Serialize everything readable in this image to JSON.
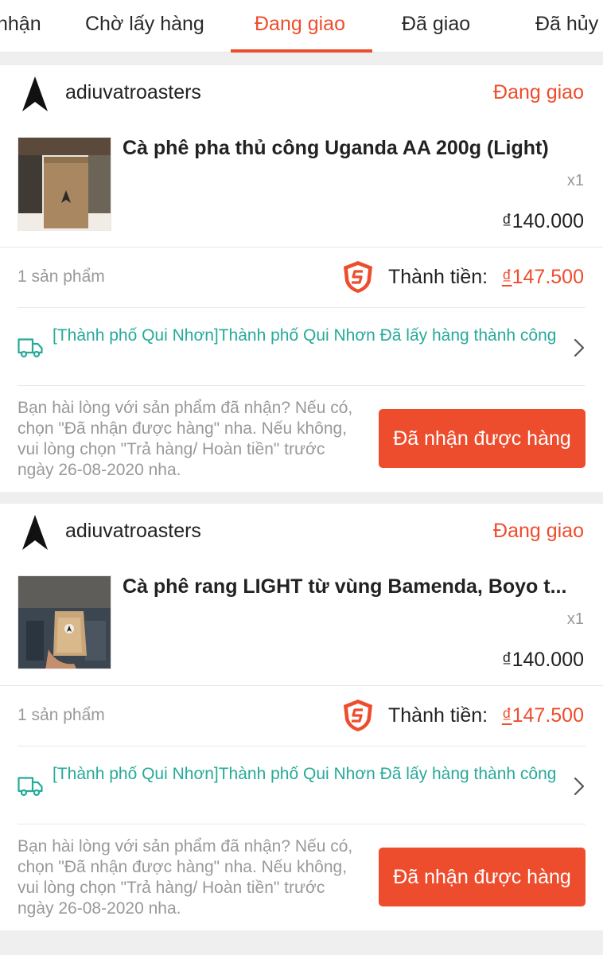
{
  "tabs": [
    {
      "label": "nhận"
    },
    {
      "label": "Chờ lấy hàng"
    },
    {
      "label": "Đang giao"
    },
    {
      "label": "Đã giao"
    },
    {
      "label": "Đã hủy"
    }
  ],
  "active_tab": "Đang giao",
  "colors": {
    "accent": "#ee4d2d",
    "shipping_teal": "#26aa99",
    "muted": "#999999"
  },
  "orders": [
    {
      "shop_name": "adiuvatroasters",
      "status": "Đang giao",
      "product": {
        "name": "Cà phê pha thủ công Uganda AA 200g (Light)",
        "quantity": "x1",
        "price": "₫140.000"
      },
      "item_count": "1 sản phẩm",
      "total_label": "Thành tiền:",
      "total_currency": "₫",
      "total_amount": "147.500",
      "shipping_status": "[Thành phố Qui Nhơn]Thành phố Qui Nhơn Đã lấy hàng thành công",
      "confirm_prompt": "Bạn hài lòng với sản phẩm đã nhận? Nếu có, chọn \"Đã nhận được hàng\" nha. Nếu không, vui lòng chọn \"Trả hàng/ Hoàn tiền\" trước ngày 26-08-2020 nha.",
      "confirm_button": "Đã nhận được hàng"
    },
    {
      "shop_name": "adiuvatroasters",
      "status": "Đang giao",
      "product": {
        "name": "Cà phê rang LIGHT từ vùng  Bamenda, Boyo t...",
        "quantity": "x1",
        "price": "₫140.000"
      },
      "item_count": "1 sản phẩm",
      "total_label": "Thành tiền:",
      "total_currency": "₫",
      "total_amount": "147.500",
      "shipping_status": "[Thành phố Qui Nhơn]Thành phố Qui Nhơn Đã lấy hàng thành công",
      "confirm_prompt": "Bạn hài lòng với sản phẩm đã nhận? Nếu có, chọn \"Đã nhận được hàng\" nha. Nếu không, vui lòng chọn \"Trả hàng/ Hoàn tiền\" trước ngày 26-08-2020 nha.",
      "confirm_button": "Đã nhận được hàng"
    }
  ]
}
